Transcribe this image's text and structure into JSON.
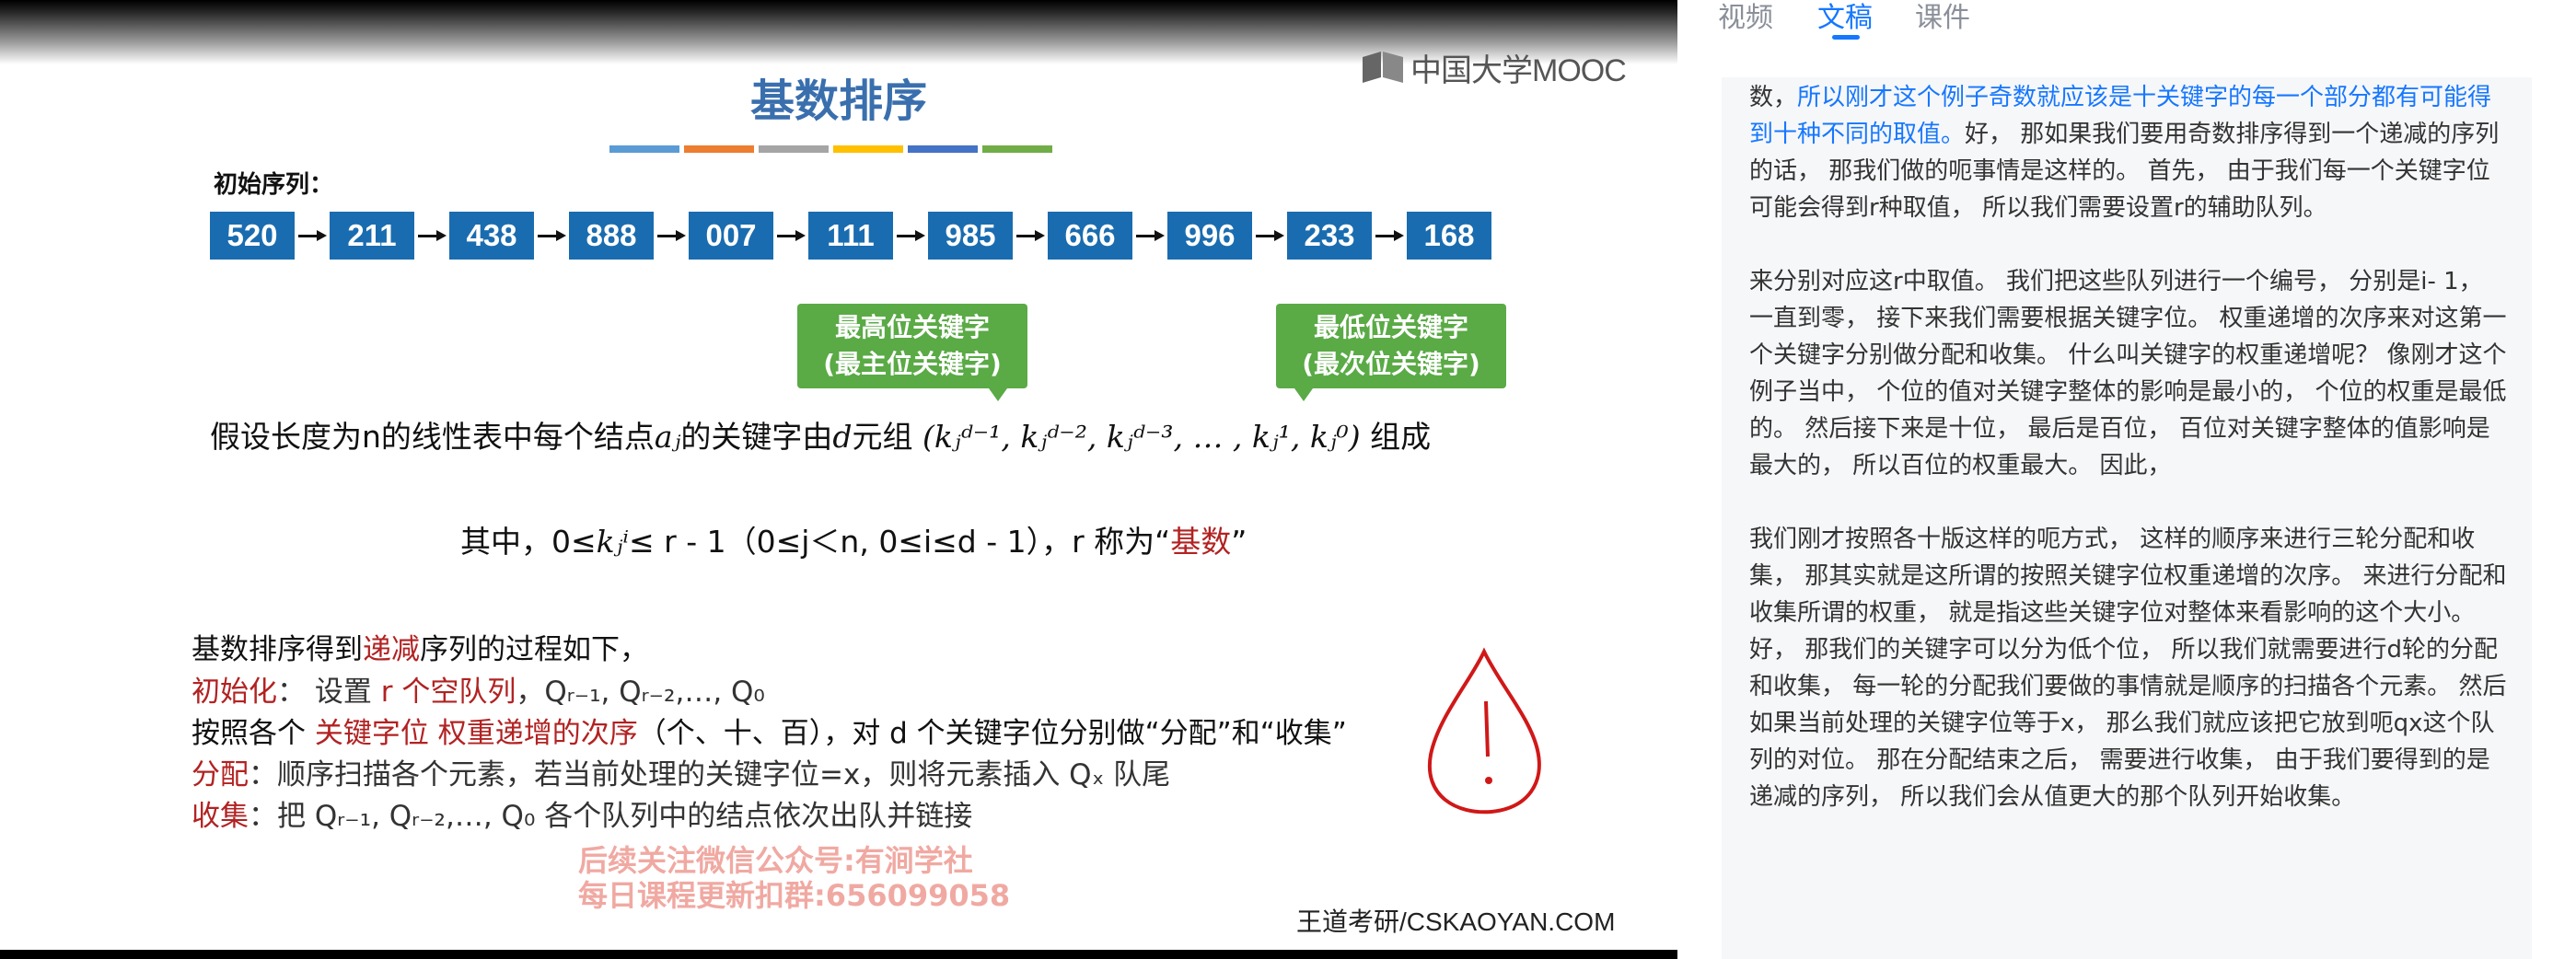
{
  "video": {
    "logo_text": "中国大学MOOC",
    "slide_title": "基数排序",
    "title_bar_colors": [
      "#5b9bd5",
      "#ed7d31",
      "#a5a5a5",
      "#ffc000",
      "#4472c4",
      "#70ad47"
    ],
    "sequence_label": "初始序列：",
    "sequence": [
      "520",
      "211",
      "438",
      "888",
      "007",
      "111",
      "985",
      "666",
      "996",
      "233",
      "168"
    ],
    "callout_high": {
      "line1": "最高位关键字",
      "line2": "(最主位关键字)"
    },
    "callout_low": {
      "line1": "最低位关键字",
      "line2": "(最次位关键字)"
    },
    "assume": {
      "prefix": "假设长度为n的线性表中每个结点",
      "a_j": "aⱼ",
      "mid": "的关键字由",
      "d": "d",
      "suffix_tuple": "元组",
      "tuple": "(kⱼᵈ⁻¹, kⱼᵈ⁻², kⱼᵈ⁻³, … , kⱼ¹, kⱼ⁰)",
      "end": "组成"
    },
    "where": {
      "prefix": "其中，0≤",
      "k": "kⱼⁱ",
      "mid": "≤ r - 1（0≤j＜n, 0≤i≤d - 1），r 称为“",
      "radix": "基数",
      "close": "”"
    },
    "process": {
      "intro_a": "基数排序得到",
      "intro_dec": "递减",
      "intro_b": "序列的过程如下，",
      "init_label": "初始化",
      "init_colon": "：  设置 ",
      "init_r": "r 个空队列",
      "init_rest": "，Qᵣ₋₁, Qᵣ₋₂,…, Q₀",
      "order_a": "按照各个 ",
      "order_red": "关键字位 权重递增的次序",
      "order_b": "（个、十、百），对 d 个关键字位分别做“分配”和“收集”",
      "dist_label": "分配",
      "dist_text": "：顺序扫描各个元素，若当前处理的关键字位=x，则将元素插入 Qₓ 队尾",
      "coll_label": "收集",
      "coll_text": "：把 Qᵣ₋₁, Qᵣ₋₂,…, Q₀ 各个队列中的结点依次出队并链接"
    },
    "watermark_line1": "后续关注微信公众号:有涧学社",
    "watermark_line2": "每日课程更新扣群:656099058",
    "credit": "王道考研/CSKAOYAN.COM"
  },
  "panel": {
    "tabs": [
      {
        "label": "视频",
        "active": false
      },
      {
        "label": "文稿",
        "active": true
      },
      {
        "label": "课件",
        "active": false
      }
    ],
    "accent_color": "#1677ff",
    "paragraphs": [
      {
        "lead": "数，",
        "highlight": "所以刚才这个例子奇数就应该是十关键字的每一个部分都有可能得到十种不同的取值。",
        "rest": "好，  那如果我们要用奇数排序得到一个递减的序列的话，  那我们做的呃事情是这样的。 首先，  由于我们每一个关键字位可能会得到r种取值，  所以我们需要设置r的辅助队列。"
      },
      {
        "text": "来分别对应这r中取值。 我们把这些队列进行一个编号，  分别是i- 1，  一直到零，  接下来我们需要根据关键字位。 权重递增的次序来对这第一个关键字分别做分配和收集。 什么叫关键字的权重递增呢？ 像刚才这个例子当中，  个位的值对关键字整体的影响是最小的，  个位的权重是最低的。 然后接下来是十位，  最后是百位，  百位对关键字整体的值影响是最大的，  所以百位的权重最大。 因此，"
      },
      {
        "text": "我们刚才按照各十版这样的呃方式，  这样的顺序来进行三轮分配和收集，  那其实就是这所谓的按照关键字位权重递增的次序。 来进行分配和收集所谓的权重，  就是指这些关键字位对整体来看影响的这个大小。 好，  那我们的关键字可以分为低个位，  所以我们就需要进行d轮的分配和收集，  每一轮的分配我们要做的事情就是顺序的扫描各个元素。 然后如果当前处理的关键字位等于x，  那么我们就应该把它放到呃qx这个队列的对位。 那在分配结束之后，  需要进行收集，  由于我们要得到的是递减的序列，  所以我们会从值更大的那个队列开始收集。"
      }
    ]
  }
}
